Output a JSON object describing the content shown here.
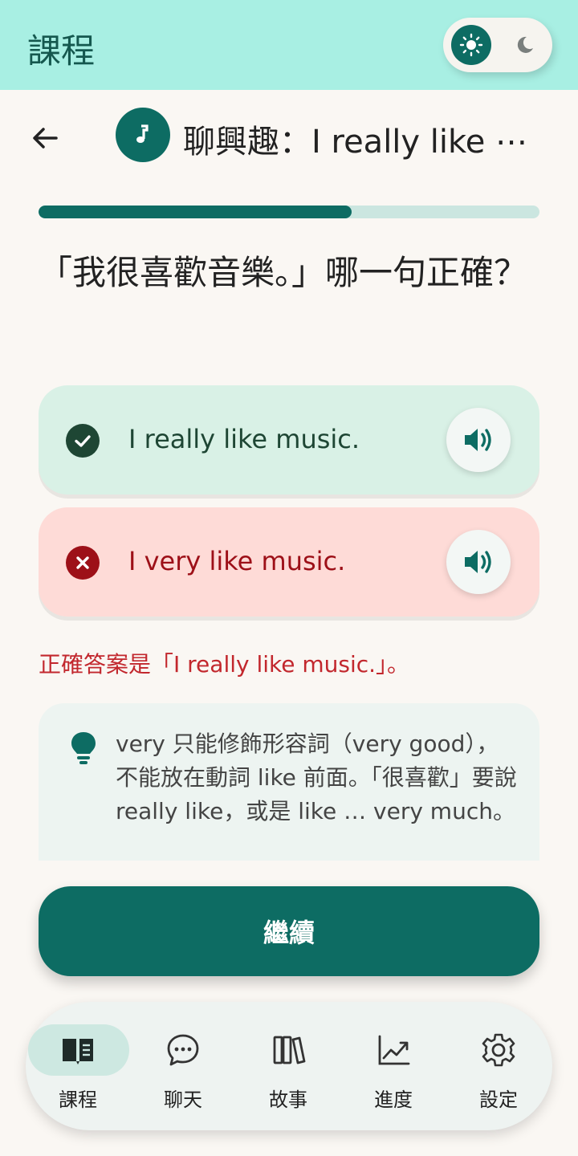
{
  "appbar": {
    "title": "課程"
  },
  "theme_toggle": {
    "light_icon": "sun-icon",
    "dark_icon": "moon-icon",
    "selected": "light"
  },
  "lesson": {
    "icon": "music-note-icon",
    "title": "聊興趣：I really like ⋯"
  },
  "progress": {
    "fraction": 0.625
  },
  "question": "「我很喜歡音樂。」哪一句正確？",
  "options": [
    {
      "text": "I really like music.",
      "status": "correct",
      "status_icon": "check-circle-icon",
      "audio_icon": "speaker-icon"
    },
    {
      "text": "I very like music.",
      "status": "wrong",
      "status_icon": "x-circle-icon",
      "audio_icon": "speaker-icon"
    }
  ],
  "feedback": {
    "correct_answer": "正確答案是「I really like music.」。"
  },
  "tip": {
    "icon": "lightbulb-icon",
    "text": "very 只能修飾形容詞（very good），不能放在動詞 like 前面。「很喜歡」要說 really like，或是 like … very much。"
  },
  "continue_label": "繼續",
  "nav": [
    {
      "label": "課程",
      "icon": "book-icon",
      "active": true
    },
    {
      "label": "聊天",
      "icon": "chat-icon",
      "active": false
    },
    {
      "label": "故事",
      "icon": "books-icon",
      "active": false
    },
    {
      "label": "進度",
      "icon": "chart-icon",
      "active": false
    },
    {
      "label": "設定",
      "icon": "gear-icon",
      "active": false
    }
  ],
  "colors": {
    "primary": "#0d6c63",
    "appbar": "#a8efe3",
    "correct_bg": "#d9f1e6",
    "wrong_bg": "#fedbd7",
    "error_text": "#c2272d"
  }
}
